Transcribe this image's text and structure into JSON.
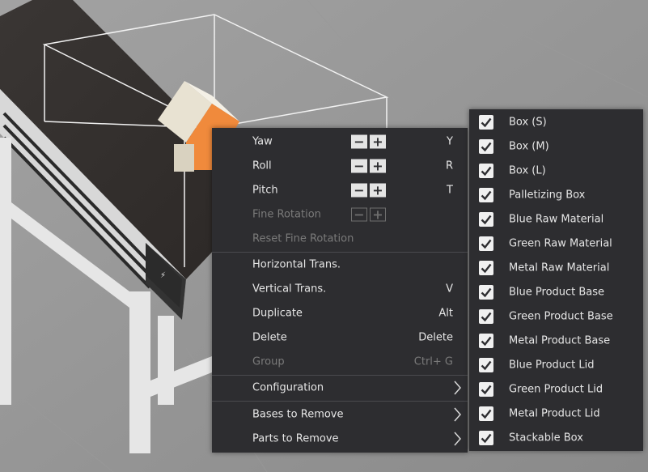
{
  "context_menu": {
    "items": [
      {
        "label": "Yaw",
        "shortcut": "Y",
        "steppers": true,
        "disabled": false
      },
      {
        "label": "Roll",
        "shortcut": "R",
        "steppers": true,
        "disabled": false
      },
      {
        "label": "Pitch",
        "shortcut": "T",
        "steppers": true,
        "disabled": false
      },
      {
        "label": "Fine Rotation",
        "shortcut": "",
        "steppers": true,
        "disabled": true
      },
      {
        "label": "Reset Fine Rotation",
        "shortcut": "",
        "disabled": true
      },
      {
        "label": "Horizontal Trans.",
        "shortcut": "",
        "disabled": false
      },
      {
        "label": "Vertical Trans.",
        "shortcut": "V",
        "disabled": false
      },
      {
        "label": "Duplicate",
        "shortcut": "Alt",
        "disabled": false
      },
      {
        "label": "Delete",
        "shortcut": "Delete",
        "disabled": false
      },
      {
        "label": "Group",
        "shortcut": "Ctrl+ G",
        "disabled": true
      },
      {
        "label": "Configuration",
        "submenu": true
      },
      {
        "label": "Bases to Remove",
        "submenu": true
      },
      {
        "label": "Parts to Remove",
        "submenu": true
      }
    ],
    "stepper_minus": "−",
    "stepper_plus": "+"
  },
  "submenu": {
    "items": [
      {
        "label": "Box (S)",
        "checked": true
      },
      {
        "label": "Box (M)",
        "checked": true
      },
      {
        "label": "Box (L)",
        "checked": true
      },
      {
        "label": "Palletizing Box",
        "checked": true
      },
      {
        "label": "Blue Raw Material",
        "checked": true
      },
      {
        "label": "Green Raw Material",
        "checked": true
      },
      {
        "label": "Metal Raw Material",
        "checked": true
      },
      {
        "label": "Blue Product Base",
        "checked": true
      },
      {
        "label": "Green Product Base",
        "checked": true
      },
      {
        "label": "Metal Product Base",
        "checked": true
      },
      {
        "label": "Blue Product Lid",
        "checked": true
      },
      {
        "label": "Green Product Lid",
        "checked": true
      },
      {
        "label": "Metal Product Lid",
        "checked": true
      },
      {
        "label": "Stackable Box",
        "checked": true
      }
    ]
  },
  "colors": {
    "menu_bg": "#2d2d30",
    "menu_text": "#e6e6e6",
    "disabled_text": "#7a7a7a",
    "object_orange": "#f08a3c"
  },
  "icons": [
    "minus-icon",
    "plus-icon",
    "chevron-right-icon",
    "checkmark-icon",
    "conveyor-sensor-icon"
  ]
}
